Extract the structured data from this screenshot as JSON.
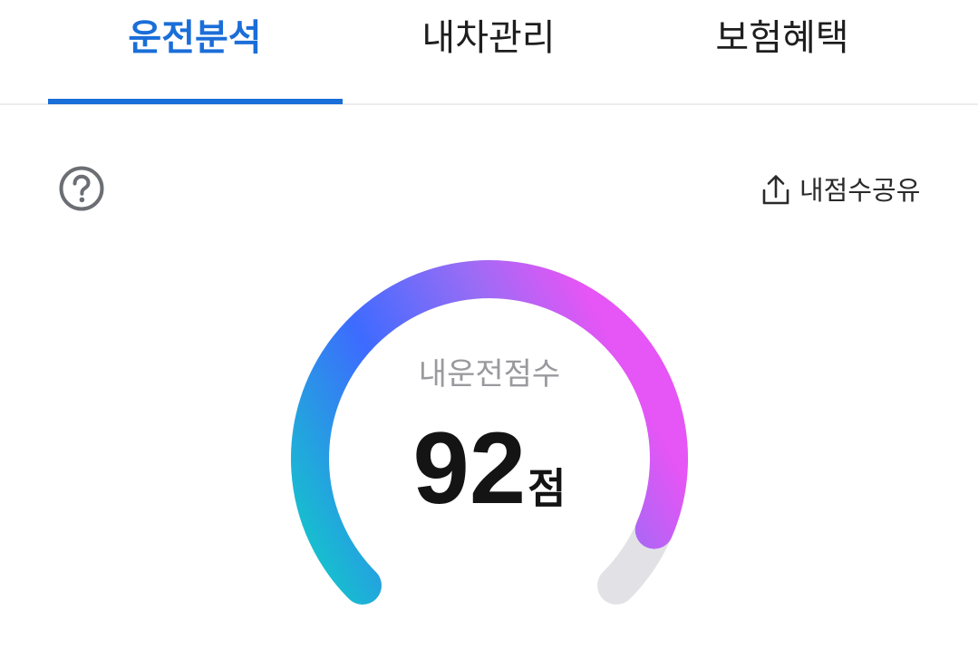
{
  "tabs": [
    {
      "label": "운전분석",
      "active": true
    },
    {
      "label": "내차관리",
      "active": false
    },
    {
      "label": "보험혜택",
      "active": false
    }
  ],
  "header": {
    "help_icon": "question-circle-icon",
    "share": {
      "label": "내점수공유",
      "icon": "share-upload-icon"
    }
  },
  "score": {
    "label": "내운전점수",
    "value": "92",
    "unit": "점",
    "max": 100
  },
  "colors": {
    "accent": "#1a6ed8",
    "gauge_start": "#12c9c9",
    "gauge_mid": "#3d6bff",
    "gauge_end": "#e655f5",
    "gauge_track": "#e2e2e6"
  }
}
